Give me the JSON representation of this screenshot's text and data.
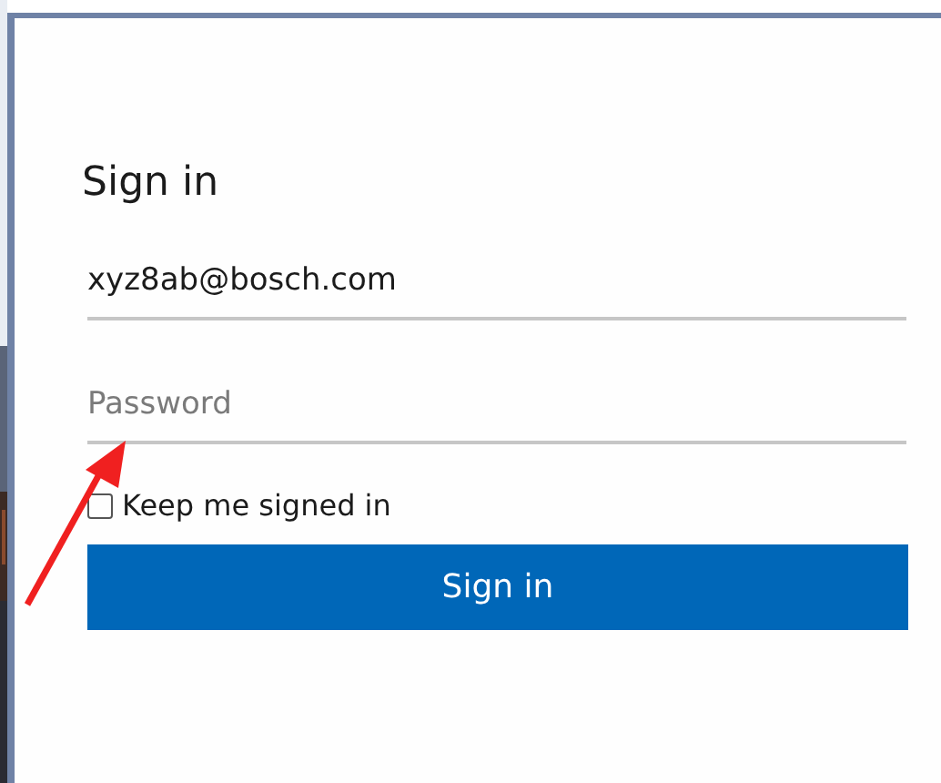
{
  "title": "Sign in",
  "email": {
    "value": "xyz8ab@bosch.com"
  },
  "password": {
    "placeholder": "Password"
  },
  "keep_signed_in": {
    "label": "Keep me signed in",
    "checked": false
  },
  "submit": {
    "label": "Sign in"
  }
}
